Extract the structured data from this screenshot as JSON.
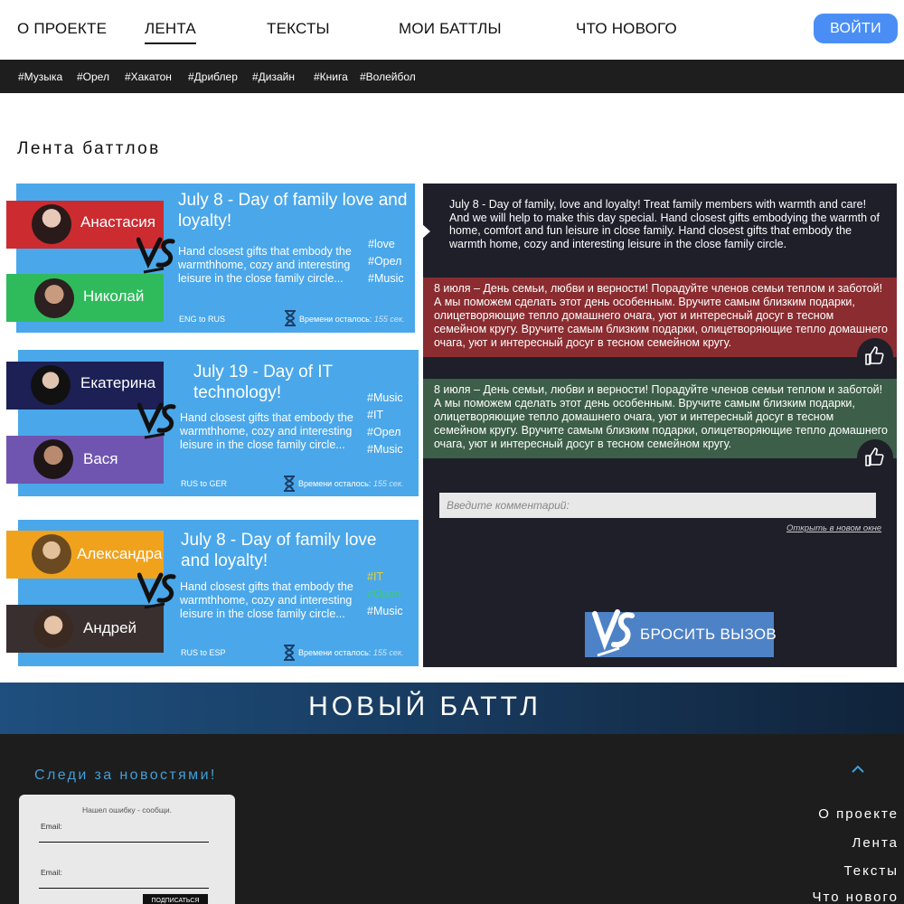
{
  "nav": {
    "items": [
      "О ПРОЕКТЕ",
      "ЛЕНТА",
      "ТЕКСТЫ",
      "МОИ БАТТЛЫ",
      "ЧТО НОВОГО"
    ],
    "login": "ВОЙТИ"
  },
  "tags": [
    "#Музыка",
    "#Орел",
    "#Хакатон",
    "#Дриблер",
    "#Дизайн",
    "#Книга",
    "#Волейбол"
  ],
  "section_title": "Лента баттлов",
  "battles": [
    {
      "player1": "Анастасия",
      "player2": "Николай",
      "title": "July 8 - Day of family love and loyalty!",
      "desc": "Hand closest gifts that embody the warmthhome, cozy and interesting leisure in the close family circle...",
      "tags": [
        "#love",
        "#Орел",
        "#Music"
      ],
      "lang": "ENG to RUS",
      "time_label": "Времени осталось:",
      "time_value": "155 сек."
    },
    {
      "player1": "Екатерина",
      "player2": "Вася",
      "title": "July 19 - Day of IT technology!",
      "desc": "Hand closest gifts that embody the warmthhome, cozy and interesting leisure in the close family circle...",
      "tags": [
        "#Music",
        "#IT",
        "#Орел",
        "#Music"
      ],
      "lang": "RUS to GER",
      "time_label": "Времени осталось:",
      "time_value": "155 сек."
    },
    {
      "player1": "Александра",
      "player2": "Андрей",
      "title": "July 8 - Day of family love and loyalty!",
      "desc": "Hand closest gifts that embody the warmthhome, cozy and interesting leisure in the close family circle...",
      "tags": [
        "#IT",
        "#Орел",
        "#Music"
      ],
      "lang": "RUS to ESP",
      "time_label": "Времени осталось:",
      "time_value": "155 сек."
    }
  ],
  "detail": {
    "original": "July 8 - Day of family, love and loyalty! Treat family members with warmth and care! And we will help to make this day special. Hand closest gifts embodying the warmth of home, comfort and fun leisure in close family. Hand closest gifts that embody the warmth home, cozy and interesting leisure in the close family circle.",
    "translation1": "8 июля – День семьи, любви и верности! Порадуйте членов семьи теплом и заботой! А мы поможем сделать этот день особенным. Вручите самым близким подарки, олицетворяющие тепло домашнего очага, уют и интересный досуг в тесном семейном кругу. Вручите самым близким подарки, олицетворяющие тепло домашнего очага, уют и интересный досуг в тесном семейном кругу.",
    "translation2": "8 июля – День семьи, любви и верности! Порадуйте членов семьи теплом и заботой! А мы поможем сделать этот день особенным. Вручите самым близким подарки, олицетворяющие тепло домашнего очага, уют и интересный досуг в тесном семейном кругу. Вручите самым близким подарки, олицетворяющие тепло домашнего очага, уют и интересный досуг в тесном семейном кругу.",
    "comment_placeholder": "Введите комментарий:",
    "open_link": "Открыть в новом окне",
    "challenge": "БРОСИТЬ ВЫЗОВ"
  },
  "banner": "НОВЫЙ БАТТЛ",
  "footer": {
    "follow": "Следи за новостями!",
    "error_text": "Нашел ошибку - сообщи.",
    "email_label": "Email:",
    "subscribe": "ПОДПИСАТЬСЯ",
    "links": [
      "О проекте",
      "Лента",
      "Тексты",
      "Что нового"
    ]
  },
  "colors": {
    "accent": "#4a8ef5",
    "card_blue": "#4aa7ea",
    "dark_panel": "#1e1f29",
    "red": "#cc2b30",
    "green": "#2fbb5c",
    "navy": "#1c2055",
    "purple": "#7055b0",
    "orange": "#f1a21c",
    "brown": "#3a2f2f",
    "translation_red": "#8a2c30",
    "translation_green": "#3d5e48"
  }
}
